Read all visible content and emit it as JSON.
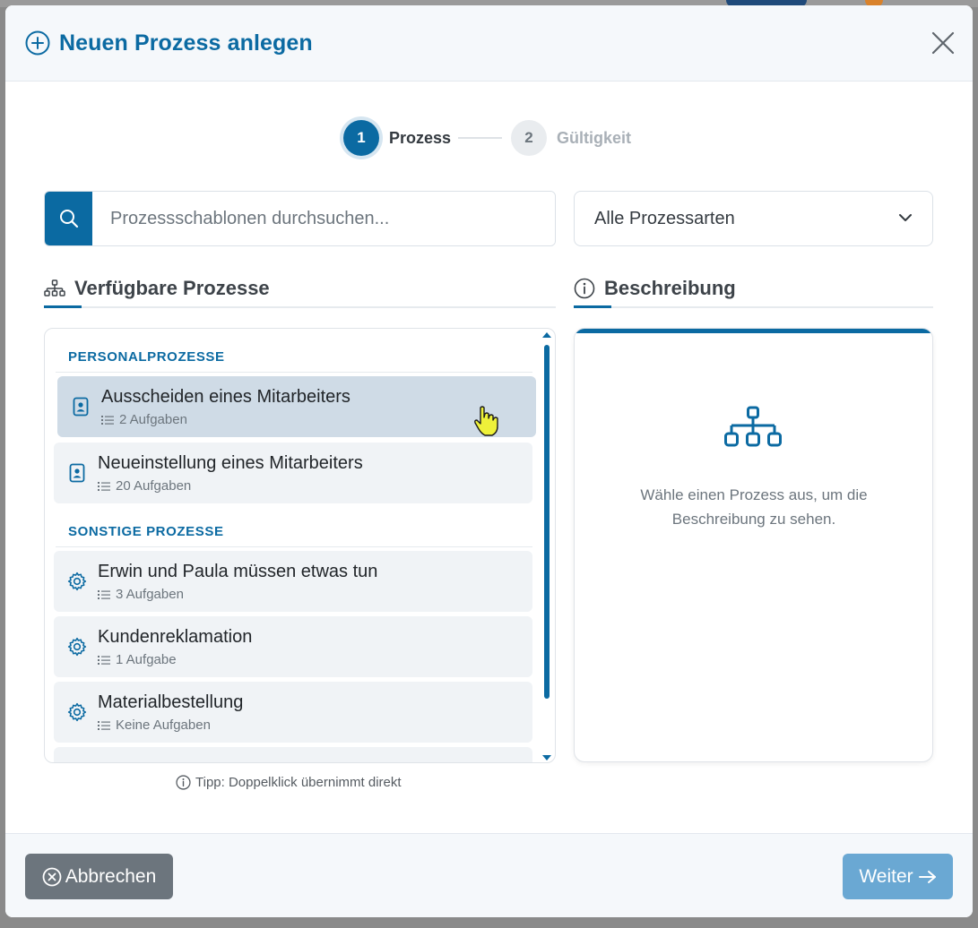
{
  "dialog": {
    "title": "Neuen Prozess anlegen",
    "close_icon": "close-icon",
    "header_icon": "plus-circle-icon"
  },
  "stepper": {
    "steps": [
      {
        "number": "1",
        "label": "Prozess",
        "active": true
      },
      {
        "number": "2",
        "label": "Gültigkeit",
        "active": false
      }
    ]
  },
  "search": {
    "placeholder": "Prozessschablonen durchsuchen...",
    "value": "",
    "icon": "search-icon"
  },
  "filter": {
    "selected": "Alle Prozessarten",
    "icon": "chevron-down-icon"
  },
  "available": {
    "heading": "Verfügbare Prozesse",
    "icon": "sitemap-icon",
    "groups": [
      {
        "label": "PERSONALPROZESSE",
        "items": [
          {
            "title": "Ausscheiden eines Mitarbeiters",
            "subtitle": "2 Aufgaben",
            "icon": "id-badge-icon",
            "selected": true
          },
          {
            "title": "Neueinstellung eines Mitarbeiters",
            "subtitle": "20 Aufgaben",
            "icon": "id-badge-icon",
            "selected": false
          }
        ]
      },
      {
        "label": "SONSTIGE PROZESSE",
        "items": [
          {
            "title": "Erwin und Paula müssen etwas tun",
            "subtitle": "3 Aufgaben",
            "icon": "gear-icon",
            "selected": false
          },
          {
            "title": "Kundenreklamation",
            "subtitle": "1 Aufgabe",
            "icon": "gear-icon",
            "selected": false
          },
          {
            "title": "Materialbestellung",
            "subtitle": "Keine Aufgaben",
            "icon": "gear-icon",
            "selected": false
          }
        ]
      }
    ],
    "tip": "Tipp: Doppelklick übernimmt direkt"
  },
  "description": {
    "heading": "Beschreibung",
    "icon": "info-icon",
    "placeholder_icon": "sitemap-icon",
    "empty_text": "Wähle einen Prozess aus, um die Beschreibung zu sehen."
  },
  "footer": {
    "cancel_label": "Abbrechen",
    "next_label": "Weiter"
  },
  "colors": {
    "primary": "#0b6aa2",
    "secondary": "#6c757d",
    "next_disabled": "#6aa8d3",
    "selected_item": "#cfdbe6"
  }
}
